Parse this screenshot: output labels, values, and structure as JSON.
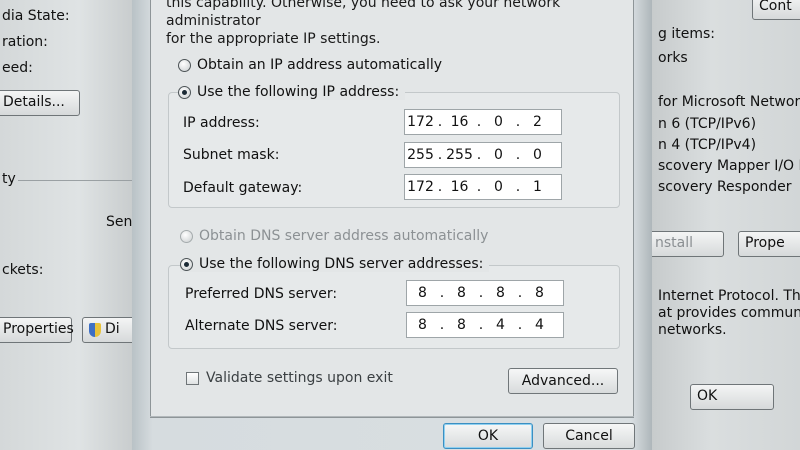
{
  "background_left": {
    "line1": "dia State:",
    "line2": "ration:",
    "line3": "eed:",
    "details_button": "Details...",
    "line4": "ty",
    "line5": "Sen",
    "line6": "ckets:",
    "properties_button": "Properties",
    "diagnose_button_fragment": "Di"
  },
  "background_right": {
    "top_button_fragment": "Cont",
    "line1": "g items:",
    "line2": "orks",
    "items": [
      "for Microsoft Networks",
      "n 6 (TCP/IPv6)",
      "n 4 (TCP/IPv4)",
      "scovery Mapper I/O Drive",
      "scovery Responder"
    ],
    "install_button": "nstall",
    "properties_button": "Prope",
    "description_lines": [
      "Internet Protocol. The de",
      "at provides communicatio",
      "networks."
    ],
    "ok_button": "OK"
  },
  "dialog": {
    "intro_line1": "this capability. Otherwise, you need to ask your network administrator",
    "intro_line2": "for the appropriate IP settings.",
    "ip_auto_label": "Obtain an IP address automatically",
    "ip_manual_label": "Use the following IP address:",
    "ip_address": {
      "label": "IP address:",
      "octets": [
        "172",
        "16",
        "0",
        "2"
      ]
    },
    "subnet_mask": {
      "label": "Subnet mask:",
      "octets": [
        "255",
        "255",
        "0",
        "0"
      ]
    },
    "default_gateway": {
      "label": "Default gateway:",
      "octets": [
        "172",
        "16",
        "0",
        "1"
      ]
    },
    "dns_auto_label": "Obtain DNS server address automatically",
    "dns_manual_label": "Use the following DNS server addresses:",
    "preferred_dns": {
      "label": "Preferred DNS server:",
      "octets": [
        "8",
        "8",
        "8",
        "8"
      ]
    },
    "alternate_dns": {
      "label": "Alternate DNS server:",
      "octets": [
        "8",
        "8",
        "4",
        "4"
      ]
    },
    "validate_label": "Validate settings upon exit",
    "advanced_button": "Advanced...",
    "ok_button": "OK",
    "cancel_button": "Cancel"
  }
}
